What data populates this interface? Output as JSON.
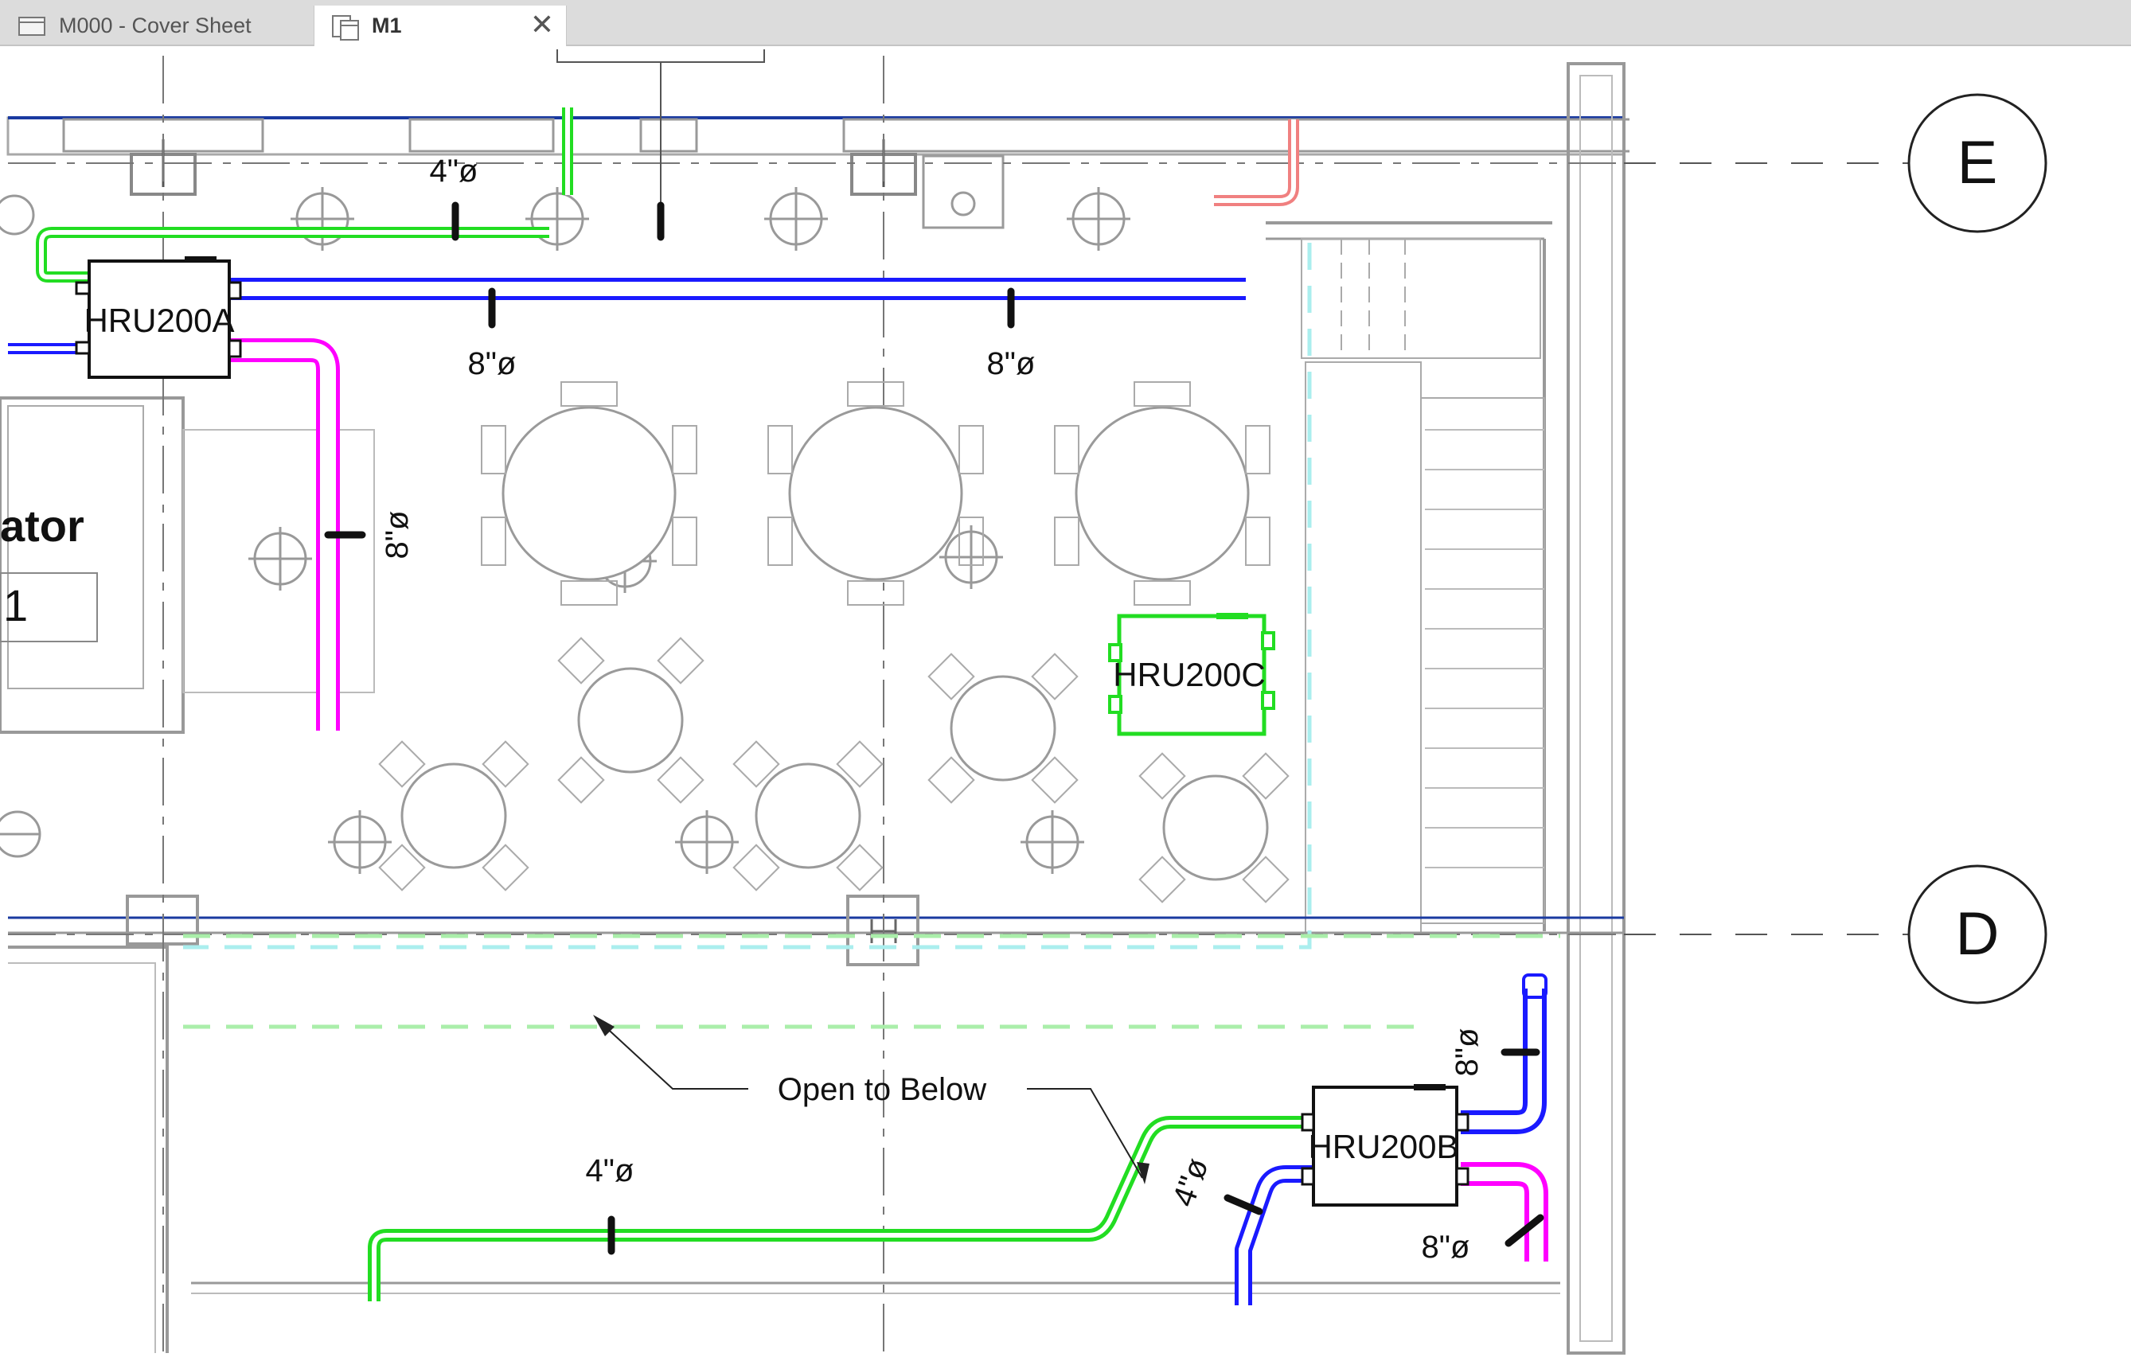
{
  "tabs": [
    {
      "label": "M000 - Cover Sheet",
      "icon": "sheet-icon",
      "active": false
    },
    {
      "label": "M1",
      "icon": "view-icon",
      "active": true,
      "close_icon": "close-icon"
    }
  ],
  "drawing": {
    "grid_lines": [
      {
        "label": "E"
      },
      {
        "label": "D"
      }
    ],
    "units": [
      {
        "tag": "HRU200A",
        "color": "#000000"
      },
      {
        "tag": "HRU200C",
        "color": "#22dd22"
      },
      {
        "tag": "HRU200B",
        "color": "#000000"
      }
    ],
    "duct_labels": {
      "top_green": "4\"ø",
      "top_blue_1": "8\"ø",
      "top_blue_2": "8\"ø",
      "magenta_left": "8\"ø",
      "bottom_green": "4\"ø",
      "b_blue_top": "8\"ø",
      "b_blue_bottom": "4\"ø",
      "b_magenta": "8\"ø"
    },
    "room_label": "ator",
    "room_number": "1",
    "annotation": "Open to Below",
    "colors": {
      "supply": "#1a1aff",
      "exhaust": "#ff00ff",
      "outdoor_air": "#22dd22",
      "relief": "#f08080",
      "background_lines": "#9a9a9a"
    }
  }
}
